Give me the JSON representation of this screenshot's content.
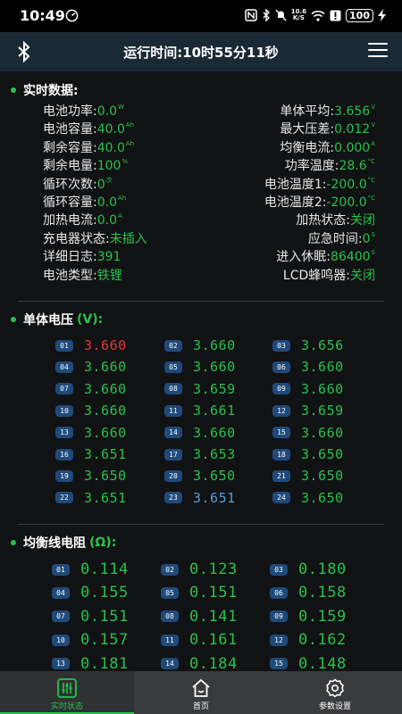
{
  "statusbar": {
    "time": "10:49",
    "net_speed_top": "10.6",
    "net_speed_bottom": "K/S",
    "battery": "100"
  },
  "header": {
    "title": "运行时间:10时55分11秒"
  },
  "realtime": {
    "title": "实时数据:",
    "left": [
      {
        "key": "电池功率:",
        "value": "0.0",
        "unit": "W"
      },
      {
        "key": "电池容量:",
        "value": "40.0",
        "unit": "Ah"
      },
      {
        "key": "剩余容量:",
        "value": "40.0",
        "unit": "Ah"
      },
      {
        "key": "剩余电量:",
        "value": "100",
        "unit": "%"
      },
      {
        "key": "循环次数:",
        "value": "0",
        "unit": "次"
      },
      {
        "key": "循环容量:",
        "value": "0.0",
        "unit": "Ah"
      },
      {
        "key": "加热电流:",
        "value": "0.0",
        "unit": "A"
      },
      {
        "key": "充电器状态:",
        "value": "未插入",
        "unit": ""
      },
      {
        "key": "详细日志:",
        "value": "391",
        "unit": ""
      },
      {
        "key": "电池类型:",
        "value": "铁锂",
        "unit": ""
      }
    ],
    "right": [
      {
        "key": "单体平均:",
        "value": "3.656",
        "unit": "V"
      },
      {
        "key": "最大压差:",
        "value": "0.012",
        "unit": "V"
      },
      {
        "key": "均衡电流:",
        "value": "0.000",
        "unit": "A"
      },
      {
        "key": "功率温度:",
        "value": "28.6",
        "unit": "°C"
      },
      {
        "key": "电池温度1:",
        "value": "-200.0",
        "unit": "°C"
      },
      {
        "key": "电池温度2:",
        "value": "-200.0",
        "unit": "°C"
      },
      {
        "key": "加热状态:",
        "value": "关闭",
        "unit": ""
      },
      {
        "key": "应急时间:",
        "value": "0",
        "unit": "S"
      },
      {
        "key": "进入休眠:",
        "value": "86400",
        "unit": "S"
      },
      {
        "key": "LCD蜂鸣器:",
        "value": "关闭",
        "unit": ""
      }
    ]
  },
  "cell_voltage": {
    "title": "单体电压",
    "paren": "(V):",
    "cells": [
      {
        "id": "01",
        "value": "3.660",
        "state": "max"
      },
      {
        "id": "02",
        "value": "3.660",
        "state": ""
      },
      {
        "id": "03",
        "value": "3.656",
        "state": ""
      },
      {
        "id": "04",
        "value": "3.660",
        "state": ""
      },
      {
        "id": "05",
        "value": "3.660",
        "state": ""
      },
      {
        "id": "06",
        "value": "3.660",
        "state": ""
      },
      {
        "id": "07",
        "value": "3.660",
        "state": ""
      },
      {
        "id": "08",
        "value": "3.659",
        "state": ""
      },
      {
        "id": "09",
        "value": "3.660",
        "state": ""
      },
      {
        "id": "10",
        "value": "3.660",
        "state": ""
      },
      {
        "id": "11",
        "value": "3.661",
        "state": ""
      },
      {
        "id": "12",
        "value": "3.659",
        "state": ""
      },
      {
        "id": "13",
        "value": "3.660",
        "state": ""
      },
      {
        "id": "14",
        "value": "3.660",
        "state": ""
      },
      {
        "id": "15",
        "value": "3.660",
        "state": ""
      },
      {
        "id": "16",
        "value": "3.651",
        "state": ""
      },
      {
        "id": "17",
        "value": "3.653",
        "state": ""
      },
      {
        "id": "18",
        "value": "3.650",
        "state": ""
      },
      {
        "id": "19",
        "value": "3.650",
        "state": ""
      },
      {
        "id": "20",
        "value": "3.650",
        "state": ""
      },
      {
        "id": "21",
        "value": "3.650",
        "state": ""
      },
      {
        "id": "22",
        "value": "3.651",
        "state": ""
      },
      {
        "id": "23",
        "value": "3.651",
        "state": "min"
      },
      {
        "id": "24",
        "value": "3.650",
        "state": ""
      }
    ]
  },
  "balance_resistance": {
    "title": "均衡线电阻",
    "paren": "(Ω):",
    "cells": [
      {
        "id": "01",
        "value": "0.114"
      },
      {
        "id": "02",
        "value": "0.123"
      },
      {
        "id": "03",
        "value": "0.180"
      },
      {
        "id": "04",
        "value": "0.155"
      },
      {
        "id": "05",
        "value": "0.151"
      },
      {
        "id": "06",
        "value": "0.158"
      },
      {
        "id": "07",
        "value": "0.151"
      },
      {
        "id": "08",
        "value": "0.141"
      },
      {
        "id": "09",
        "value": "0.159"
      },
      {
        "id": "10",
        "value": "0.157"
      },
      {
        "id": "11",
        "value": "0.161"
      },
      {
        "id": "12",
        "value": "0.162"
      },
      {
        "id": "13",
        "value": "0.181"
      },
      {
        "id": "14",
        "value": "0.184"
      },
      {
        "id": "15",
        "value": "0.148"
      }
    ]
  },
  "nav": {
    "items": [
      {
        "label": "实时状态",
        "icon": "sliders-icon",
        "active": true
      },
      {
        "label": "首页",
        "icon": "home-icon",
        "active": false
      },
      {
        "label": "参数设置",
        "icon": "gear-icon",
        "active": false
      }
    ]
  },
  "colors": {
    "accent": "#27c24c",
    "max_cell": "#e53935",
    "min_cell": "#5b9bd5",
    "badge": "#1f4a7a",
    "header_bg": "#1a2a35"
  }
}
